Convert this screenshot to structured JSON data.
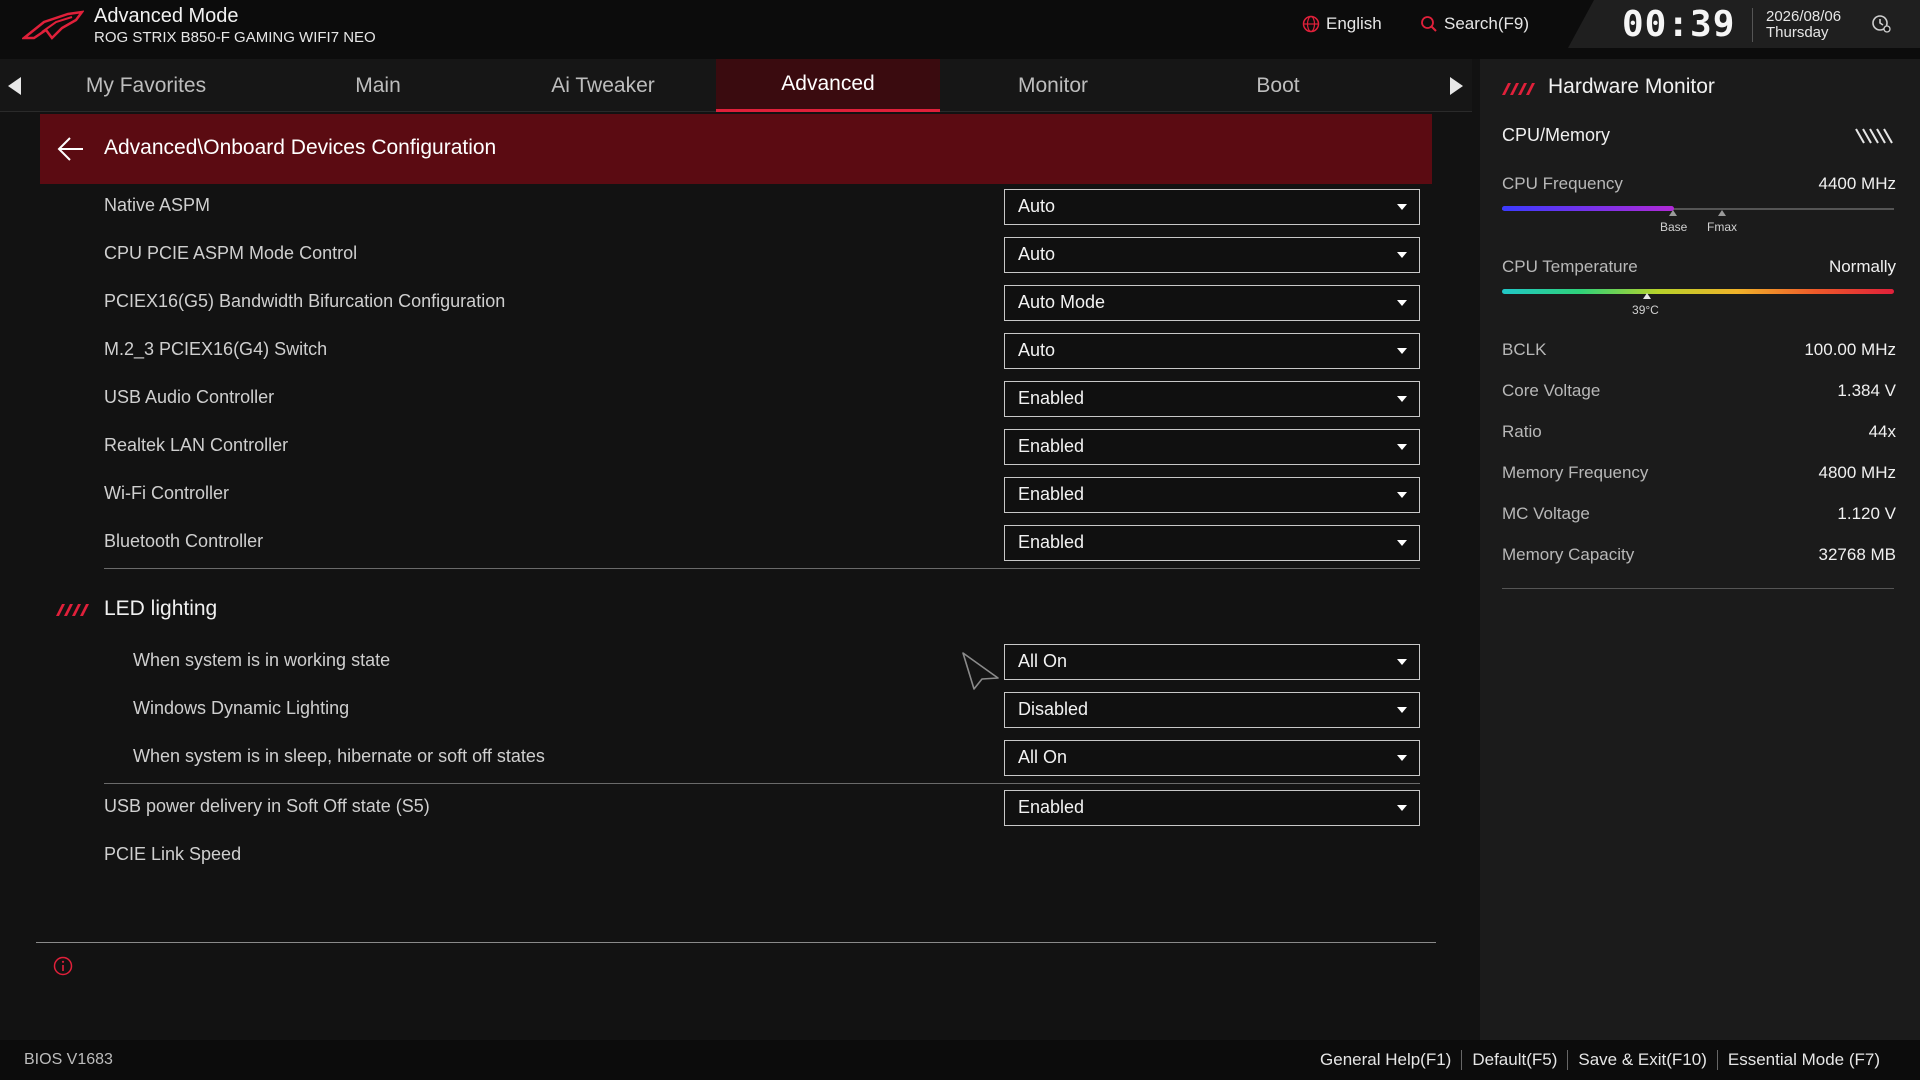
{
  "header": {
    "mode_title": "Advanced Mode",
    "board_name": "ROG STRIX B850-F GAMING WIFI7 NEO",
    "language": "English",
    "search": "Search(F9)",
    "time": "00:39",
    "date": "2026/08/06",
    "weekday": "Thursday"
  },
  "tabs": [
    {
      "label": "My Favorites"
    },
    {
      "label": "Main"
    },
    {
      "label": "Ai Tweaker"
    },
    {
      "label": "Advanced",
      "active": true
    },
    {
      "label": "Monitor"
    },
    {
      "label": "Boot"
    }
  ],
  "breadcrumb": "Advanced\\Onboard Devices Configuration",
  "settings": [
    {
      "label": "Native ASPM",
      "value": "Auto"
    },
    {
      "label": "CPU PCIE ASPM Mode Control",
      "value": "Auto"
    },
    {
      "label": "PCIEX16(G5) Bandwidth Bifurcation Configuration",
      "value": "Auto Mode"
    },
    {
      "label": "M.2_3 PCIEX16(G4) Switch",
      "value": "Auto"
    },
    {
      "label": "USB Audio Controller",
      "value": "Enabled"
    },
    {
      "label": "Realtek LAN Controller",
      "value": "Enabled"
    },
    {
      "label": "Wi-Fi Controller",
      "value": "Enabled"
    },
    {
      "label": "Bluetooth Controller",
      "value": "Enabled"
    }
  ],
  "led_section": {
    "title": "LED lighting",
    "items": [
      {
        "label": "When system is in working state",
        "value": "All On"
      },
      {
        "label": "Windows Dynamic Lighting",
        "value": "Disabled"
      },
      {
        "label": "When system is in sleep, hibernate or soft off states",
        "value": "All On"
      }
    ]
  },
  "usb_power": {
    "label": "USB power delivery in Soft Off state (S5)",
    "value": "Enabled"
  },
  "pcie_link": {
    "label": "PCIE Link Speed"
  },
  "hardware_monitor": {
    "title": "Hardware Monitor",
    "section": "CPU/Memory",
    "cpu_frequency": {
      "label": "CPU Frequency",
      "value": "4400 MHz",
      "fill_fraction": 0.44,
      "marker_base": "Base",
      "marker_fmax": "Fmax"
    },
    "cpu_temperature": {
      "label": "CPU Temperature",
      "value": "Normally",
      "reading": "39°C",
      "position_fraction": 0.37
    },
    "rows": [
      {
        "label": "BCLK",
        "value": "100.00 MHz"
      },
      {
        "label": "Core Voltage",
        "value": "1.384 V"
      },
      {
        "label": "Ratio",
        "value": "44x"
      },
      {
        "label": "Memory Frequency",
        "value": "4800 MHz"
      },
      {
        "label": "MC Voltage",
        "value": "1.120 V"
      },
      {
        "label": "Memory Capacity",
        "value": "32768 MB"
      }
    ]
  },
  "footer": {
    "version": "BIOS V1683",
    "keys": [
      "General Help(F1)",
      "Default(F5)",
      "Save & Exit(F10)",
      "Essential Mode (F7)"
    ]
  },
  "colors": {
    "accent": "#e0203a",
    "breadcrumb_bg": "#5b0b12",
    "active_tab_bg": "#3a0b0f"
  }
}
